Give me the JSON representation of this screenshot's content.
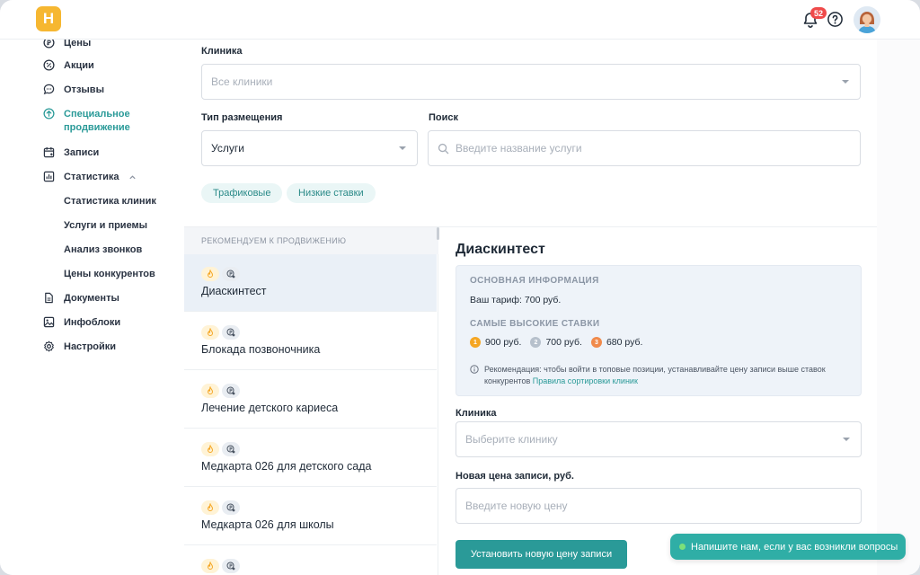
{
  "app": {
    "logo_letter": "H"
  },
  "topbar": {
    "notifications_count": "52"
  },
  "sidebar": {
    "items": [
      {
        "label": "Цены",
        "icon": "price-icon"
      },
      {
        "label": "Акции",
        "icon": "percent-icon"
      },
      {
        "label": "Отзывы",
        "icon": "reviews-icon"
      },
      {
        "label": "Специальное продвижение",
        "icon": "promotion-icon",
        "active": true
      },
      {
        "label": "Записи",
        "icon": "calendar-icon"
      },
      {
        "label": "Статистика",
        "icon": "statistics-icon",
        "expanded": true
      },
      {
        "label": "Документы",
        "icon": "document-icon"
      },
      {
        "label": "Инфоблоки",
        "icon": "image-icon"
      },
      {
        "label": "Настройки",
        "icon": "gear-icon"
      }
    ],
    "statistics_subitems": [
      "Статистика клиник",
      "Услуги и приемы",
      "Анализ звонков",
      "Цены конкурентов"
    ]
  },
  "filters": {
    "clinic_label": "Клиника",
    "clinic_placeholder": "Все клиники",
    "placement_label": "Тип размещения",
    "placement_value": "Услуги",
    "search_label": "Поиск",
    "search_placeholder": "Введите название услуги",
    "chips": [
      "Трафиковые",
      "Низкие ставки"
    ]
  },
  "list": {
    "header": "РЕКОМЕНДУЕМ К ПРОДВИЖЕНИЮ",
    "items": [
      {
        "title": "Диаскинтест",
        "selected": true
      },
      {
        "title": "Блокада позвоночника"
      },
      {
        "title": "Лечение детского кариеса"
      },
      {
        "title": "Медкарта 026 для детского сада"
      },
      {
        "title": "Медкарта 026 для школы"
      },
      {
        "title": ""
      }
    ]
  },
  "detail": {
    "title": "Диаскинтест",
    "basic_info_heading": "ОСНОВНАЯ ИНФОРМАЦИЯ",
    "tariff_text": "Ваш тариф: 700 руб.",
    "top_rates_heading": "САМЫЕ ВЫСОКИЕ СТАВКИ",
    "rates": [
      {
        "rank": "1",
        "value": "900 руб.",
        "color": "#f5a623"
      },
      {
        "rank": "2",
        "value": "700 руб.",
        "color": "#b6c0cc"
      },
      {
        "rank": "3",
        "value": "680 руб.",
        "color": "#f08a4b"
      }
    ],
    "note_text": "Рекомендация: чтобы войти в топовые позиции, устанавливайте цену записи выше ставок конкурентов",
    "note_link": "Правила сортировки клиник",
    "clinic_label": "Клиника",
    "clinic_placeholder": "Выберите клинику",
    "price_label": "Новая цена записи, руб.",
    "price_placeholder": "Введите новую цену",
    "submit_label": "Установить новую цену записи"
  },
  "chat": {
    "label": "Напишите нам, если у вас возникли вопросы"
  },
  "colors": {
    "accent": "#2a9a98",
    "logo": "#f6b731",
    "badge": "#ef4a4a"
  }
}
